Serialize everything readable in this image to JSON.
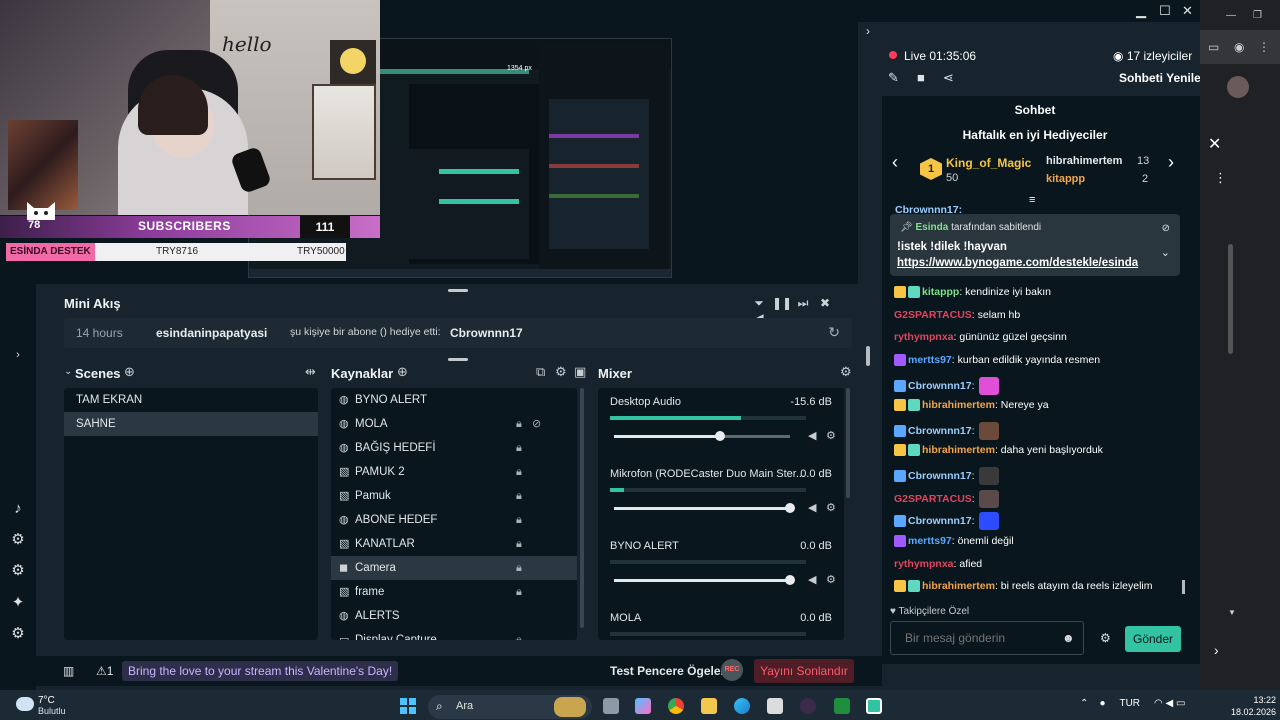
{
  "overlay": {
    "hello": "hello",
    "sub_count": "78",
    "sub_label": "SUBSCRIBERS",
    "sub_number": "111",
    "ticker": [
      "ESİNDA DESTEK",
      "TRY8716",
      "TRY50000"
    ]
  },
  "preview_inner": {
    "size_label": "1354 px"
  },
  "miniflow": {
    "title": "Mini Akış",
    "row": {
      "time": "14 hours",
      "user": "esindaninpapatyasi",
      "message": "şu kişiye bir abone () hediye etti:",
      "target": "Cbrownnn17"
    }
  },
  "scenes": {
    "title": "Scenes",
    "items": [
      {
        "label": "TAM EKRAN",
        "selected": false
      },
      {
        "label": "SAHNE",
        "selected": true
      }
    ]
  },
  "sources": {
    "title": "Kaynaklar",
    "items": [
      {
        "label": "BYNO ALERT",
        "icon": "globe-icon",
        "selected": false
      },
      {
        "label": "MOLA",
        "icon": "globe-icon",
        "selected": false
      },
      {
        "label": "BAĞIŞ HEDEFİ",
        "icon": "globe-icon",
        "selected": false
      },
      {
        "label": "PAMUK 2",
        "icon": "image-icon",
        "selected": false
      },
      {
        "label": "Pamuk",
        "icon": "image-icon",
        "selected": false
      },
      {
        "label": "ABONE HEDEF",
        "icon": "globe-icon",
        "selected": false
      },
      {
        "label": "KANATLAR",
        "icon": "image-icon",
        "selected": false
      },
      {
        "label": "Camera",
        "icon": "camera-icon",
        "selected": true
      },
      {
        "label": "frame",
        "icon": "image-icon",
        "selected": false
      },
      {
        "label": "ALERTS",
        "icon": "globe-icon",
        "selected": false
      },
      {
        "label": "Display Capture",
        "icon": "monitor-icon",
        "selected": false
      }
    ]
  },
  "mixer": {
    "title": "Mixer",
    "channels": [
      {
        "name": "Desktop Audio",
        "db": "-15.6 dB",
        "meter": 0.67,
        "volume": 0.6
      },
      {
        "name": "Mikrofon (RODECaster Duo Main Ster...",
        "db": "0.0 dB",
        "meter": 0.07,
        "volume": 1.0
      },
      {
        "name": "BYNO ALERT",
        "db": "0.0 dB",
        "meter": 0.0,
        "volume": 1.0
      },
      {
        "name": "MOLA",
        "db": "0.0 dB",
        "meter": 0.0,
        "volume": 1.0
      }
    ]
  },
  "bottombar": {
    "badge": "1",
    "valentine": "Bring the love to your stream this Valentine's Day!",
    "test_window": "Test Pencere Ögeleri",
    "rec": "REC",
    "end_stream": "Yayını Sonlandır"
  },
  "chat": {
    "live_label": "Live",
    "live_time": "01:35:06",
    "viewers": "17 izleyiciler",
    "refresh": "Sohbeti Yenile",
    "title": "Sohbet",
    "gifters_title": "Haftalık en iyi Hediyeciler",
    "gifters": [
      {
        "rank": "1",
        "name": "King_of_Magic",
        "value": "50"
      },
      {
        "name": "hibrahimertem",
        "value": "13"
      },
      {
        "name": "kitappp",
        "value": "2"
      }
    ],
    "pinned_by_user": "Esinda",
    "pinned_by_text": "tarafından sabitlendi",
    "pinned_text": "!istek !dilek !hayvan",
    "pinned_link": "https://www.bynogame.com/destekle/esinda",
    "partial_user": "Cbrownnn17:",
    "messages": [
      {
        "user": "kitappp",
        "text": ": kendinize iyi bakın",
        "color": "#7fe18a"
      },
      {
        "user": "G2SPARTACUS",
        "text": ": selam hb",
        "color": "#e0455e"
      },
      {
        "user": "rythympnxa",
        "text": ": gününüz güzel geçsinn",
        "color": "#e0455e"
      },
      {
        "user": "mertts97",
        "text": ": kurban edildik yayında resmen",
        "color": "#5aa8ff"
      },
      {
        "user": "Cbrownnn17",
        "text": ":",
        "color": "#9ccfff"
      },
      {
        "user": "hibrahimertem",
        "text": ": Nereye ya",
        "color": "#f2a54a"
      },
      {
        "user": "Cbrownnn17",
        "text": ":",
        "color": "#9ccfff"
      },
      {
        "user": "hibrahimertem",
        "text": ": daha yeni başlıyorduk",
        "color": "#f2a54a"
      },
      {
        "user": "Cbrownnn17",
        "text": ":",
        "color": "#9ccfff"
      },
      {
        "user": "G2SPARTACUS",
        "text": ":",
        "color": "#e0455e"
      },
      {
        "user": "Cbrownnn17",
        "text": ":",
        "color": "#9ccfff"
      },
      {
        "user": "mertts97",
        "text": ": önemli değil",
        "color": "#5aa8ff"
      },
      {
        "user": "rythympnxa",
        "text": ": afied",
        "color": "#e0455e"
      },
      {
        "user": "hibrahimertem",
        "text": ": bi reels atayım da reels izleyelim",
        "color": "#f2a54a"
      }
    ],
    "followers_only": "Takipçilere Özel",
    "input_placeholder": "Bir mesaj gönderin",
    "send": "Gönder"
  },
  "taskbar": {
    "weather_temp": "7°C",
    "weather_desc": "Bulutlu",
    "search": "Ara",
    "lang": "TUR",
    "time": "13:22",
    "date": "18.02.2026"
  }
}
